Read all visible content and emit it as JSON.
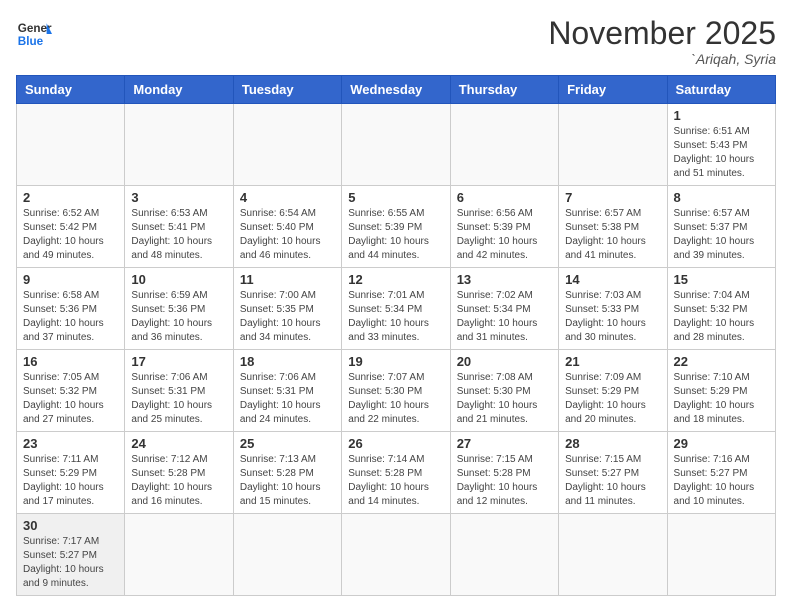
{
  "header": {
    "logo_general": "General",
    "logo_blue": "Blue",
    "month_title": "November 2025",
    "location": "`Ariqah, Syria"
  },
  "weekdays": [
    "Sunday",
    "Monday",
    "Tuesday",
    "Wednesday",
    "Thursday",
    "Friday",
    "Saturday"
  ],
  "days": [
    {
      "num": "",
      "info": ""
    },
    {
      "num": "",
      "info": ""
    },
    {
      "num": "",
      "info": ""
    },
    {
      "num": "",
      "info": ""
    },
    {
      "num": "",
      "info": ""
    },
    {
      "num": "",
      "info": ""
    },
    {
      "num": "1",
      "info": "Sunrise: 6:51 AM\nSunset: 5:43 PM\nDaylight: 10 hours and 51 minutes."
    },
    {
      "num": "2",
      "info": "Sunrise: 6:52 AM\nSunset: 5:42 PM\nDaylight: 10 hours and 49 minutes."
    },
    {
      "num": "3",
      "info": "Sunrise: 6:53 AM\nSunset: 5:41 PM\nDaylight: 10 hours and 48 minutes."
    },
    {
      "num": "4",
      "info": "Sunrise: 6:54 AM\nSunset: 5:40 PM\nDaylight: 10 hours and 46 minutes."
    },
    {
      "num": "5",
      "info": "Sunrise: 6:55 AM\nSunset: 5:39 PM\nDaylight: 10 hours and 44 minutes."
    },
    {
      "num": "6",
      "info": "Sunrise: 6:56 AM\nSunset: 5:39 PM\nDaylight: 10 hours and 42 minutes."
    },
    {
      "num": "7",
      "info": "Sunrise: 6:57 AM\nSunset: 5:38 PM\nDaylight: 10 hours and 41 minutes."
    },
    {
      "num": "8",
      "info": "Sunrise: 6:57 AM\nSunset: 5:37 PM\nDaylight: 10 hours and 39 minutes."
    },
    {
      "num": "9",
      "info": "Sunrise: 6:58 AM\nSunset: 5:36 PM\nDaylight: 10 hours and 37 minutes."
    },
    {
      "num": "10",
      "info": "Sunrise: 6:59 AM\nSunset: 5:36 PM\nDaylight: 10 hours and 36 minutes."
    },
    {
      "num": "11",
      "info": "Sunrise: 7:00 AM\nSunset: 5:35 PM\nDaylight: 10 hours and 34 minutes."
    },
    {
      "num": "12",
      "info": "Sunrise: 7:01 AM\nSunset: 5:34 PM\nDaylight: 10 hours and 33 minutes."
    },
    {
      "num": "13",
      "info": "Sunrise: 7:02 AM\nSunset: 5:34 PM\nDaylight: 10 hours and 31 minutes."
    },
    {
      "num": "14",
      "info": "Sunrise: 7:03 AM\nSunset: 5:33 PM\nDaylight: 10 hours and 30 minutes."
    },
    {
      "num": "15",
      "info": "Sunrise: 7:04 AM\nSunset: 5:32 PM\nDaylight: 10 hours and 28 minutes."
    },
    {
      "num": "16",
      "info": "Sunrise: 7:05 AM\nSunset: 5:32 PM\nDaylight: 10 hours and 27 minutes."
    },
    {
      "num": "17",
      "info": "Sunrise: 7:06 AM\nSunset: 5:31 PM\nDaylight: 10 hours and 25 minutes."
    },
    {
      "num": "18",
      "info": "Sunrise: 7:06 AM\nSunset: 5:31 PM\nDaylight: 10 hours and 24 minutes."
    },
    {
      "num": "19",
      "info": "Sunrise: 7:07 AM\nSunset: 5:30 PM\nDaylight: 10 hours and 22 minutes."
    },
    {
      "num": "20",
      "info": "Sunrise: 7:08 AM\nSunset: 5:30 PM\nDaylight: 10 hours and 21 minutes."
    },
    {
      "num": "21",
      "info": "Sunrise: 7:09 AM\nSunset: 5:29 PM\nDaylight: 10 hours and 20 minutes."
    },
    {
      "num": "22",
      "info": "Sunrise: 7:10 AM\nSunset: 5:29 PM\nDaylight: 10 hours and 18 minutes."
    },
    {
      "num": "23",
      "info": "Sunrise: 7:11 AM\nSunset: 5:29 PM\nDaylight: 10 hours and 17 minutes."
    },
    {
      "num": "24",
      "info": "Sunrise: 7:12 AM\nSunset: 5:28 PM\nDaylight: 10 hours and 16 minutes."
    },
    {
      "num": "25",
      "info": "Sunrise: 7:13 AM\nSunset: 5:28 PM\nDaylight: 10 hours and 15 minutes."
    },
    {
      "num": "26",
      "info": "Sunrise: 7:14 AM\nSunset: 5:28 PM\nDaylight: 10 hours and 14 minutes."
    },
    {
      "num": "27",
      "info": "Sunrise: 7:15 AM\nSunset: 5:28 PM\nDaylight: 10 hours and 12 minutes."
    },
    {
      "num": "28",
      "info": "Sunrise: 7:15 AM\nSunset: 5:27 PM\nDaylight: 10 hours and 11 minutes."
    },
    {
      "num": "29",
      "info": "Sunrise: 7:16 AM\nSunset: 5:27 PM\nDaylight: 10 hours and 10 minutes."
    },
    {
      "num": "30",
      "info": "Sunrise: 7:17 AM\nSunset: 5:27 PM\nDaylight: 10 hours and 9 minutes."
    },
    {
      "num": "",
      "info": ""
    },
    {
      "num": "",
      "info": ""
    },
    {
      "num": "",
      "info": ""
    },
    {
      "num": "",
      "info": ""
    },
    {
      "num": "",
      "info": ""
    },
    {
      "num": "",
      "info": ""
    }
  ]
}
